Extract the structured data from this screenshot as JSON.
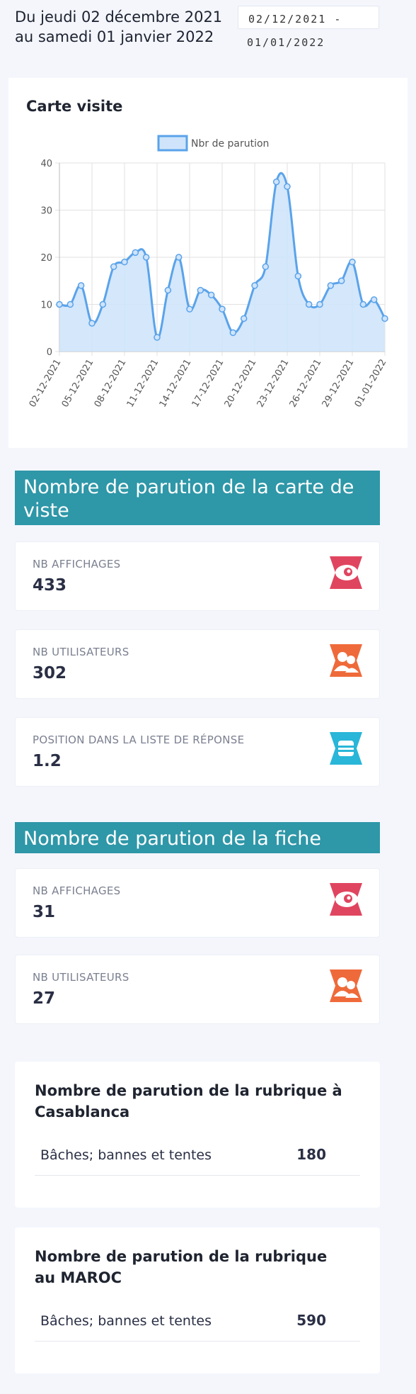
{
  "header": {
    "period_text": "Du jeudi 02 décembre 2021 au samedi 01 janvier 2022",
    "range_start": "02/12/2021 -",
    "range_end": "01/01/2022"
  },
  "chart_card": {
    "title": "Carte visite"
  },
  "chart_data": {
    "type": "area",
    "title": "Carte visite",
    "series": [
      {
        "name": "Nbr de parution",
        "values": [
          10,
          10,
          14,
          6,
          10,
          18,
          19,
          21,
          20,
          3,
          13,
          20,
          9,
          13,
          12,
          9,
          4,
          7,
          14,
          18,
          36,
          35,
          16,
          10,
          10,
          14,
          15,
          19,
          10,
          11,
          7
        ]
      }
    ],
    "x": [
      "02-12-2021",
      "03-12-2021",
      "04-12-2021",
      "05-12-2021",
      "06-12-2021",
      "07-12-2021",
      "08-12-2021",
      "09-12-2021",
      "10-12-2021",
      "11-12-2021",
      "12-12-2021",
      "13-12-2021",
      "14-12-2021",
      "15-12-2021",
      "16-12-2021",
      "17-12-2021",
      "18-12-2021",
      "19-12-2021",
      "20-12-2021",
      "21-12-2021",
      "22-12-2021",
      "23-12-2021",
      "24-12-2021",
      "25-12-2021",
      "26-12-2021",
      "27-12-2021",
      "28-12-2021",
      "29-12-2021",
      "30-12-2021",
      "31-12-2021",
      "01-01-2022"
    ],
    "tick_labels": [
      "02-12-2021",
      "05-12-2021",
      "08-12-2021",
      "11-12-2021",
      "14-12-2021",
      "17-12-2021",
      "20-12-2021",
      "23-12-2021",
      "26-12-2021",
      "29-12-2021",
      "01-01-2022"
    ],
    "y_ticks": [
      0,
      10,
      20,
      30,
      40
    ],
    "ylim": [
      0,
      40
    ],
    "grid": true,
    "legend": "top-center",
    "colors": {
      "line": "#5aa3ea",
      "fill": "#cfe4fb"
    }
  },
  "section_carte": {
    "title": "Nombre de parution de la carte de viste",
    "stats": [
      {
        "label": "NB AFFICHAGES",
        "value": "433",
        "icon": "eye-icon"
      },
      {
        "label": "NB UTILISATEURS",
        "value": "302",
        "icon": "users-icon"
      },
      {
        "label": "POSITION DANS LA LISTE DE RÉPONSE",
        "value": "1.2",
        "icon": "list-position-icon"
      }
    ]
  },
  "section_fiche": {
    "title": "Nombre de parution de la fiche",
    "stats": [
      {
        "label": "NB AFFICHAGES",
        "value": "31",
        "icon": "eye-icon"
      },
      {
        "label": "NB UTILISATEURS",
        "value": "27",
        "icon": "users-icon"
      }
    ]
  },
  "rubrique_casablanca": {
    "title": "Nombre de parution de la rubrique à Casablanca",
    "rows": [
      {
        "name": "Bâches; bannes et tentes",
        "count": "180"
      }
    ]
  },
  "rubrique_maroc": {
    "title": "Nombre de parution de la rubrique au MAROC",
    "rows": [
      {
        "name": "Bâches; bannes et tentes",
        "count": "590"
      }
    ]
  },
  "colors": {
    "background": "#f4f6fc",
    "section_header": "#2e97a8",
    "icon_pink": "#e0455f",
    "icon_orange": "#ef6a3a",
    "icon_cyan": "#29b6d8"
  }
}
